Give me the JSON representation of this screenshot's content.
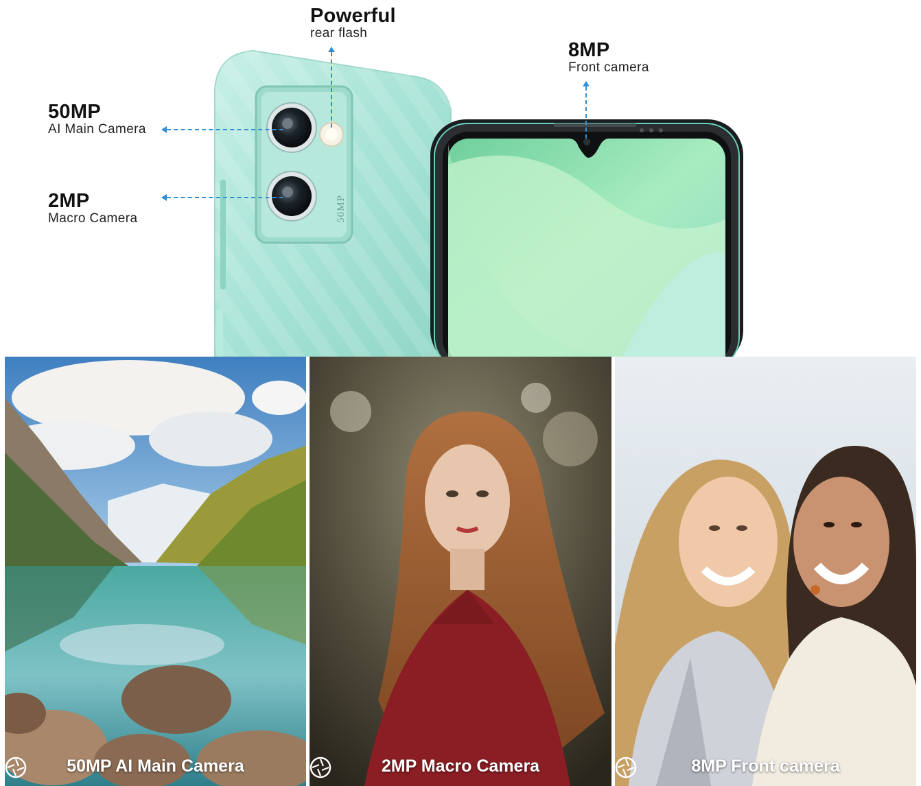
{
  "callouts": {
    "rear_flash": {
      "big": "Powerful",
      "small": "rear flash"
    },
    "front_camera": {
      "big": "8MP",
      "small": "Front camera"
    },
    "main_camera": {
      "big": "50MP",
      "small": "AI Main Camera"
    },
    "macro_camera": {
      "big": "2MP",
      "small": "Macro Camera"
    }
  },
  "phone": {
    "module_label": "50MP",
    "body_color": "#a7e3d6",
    "accent_color": "#2f8fd8"
  },
  "samples": [
    {
      "caption": "50MP AI Main Camera",
      "icon": "aperture-icon"
    },
    {
      "caption": "2MP Macro Camera",
      "icon": "aperture-icon"
    },
    {
      "caption": "8MP Front camera",
      "icon": "aperture-icon"
    }
  ]
}
